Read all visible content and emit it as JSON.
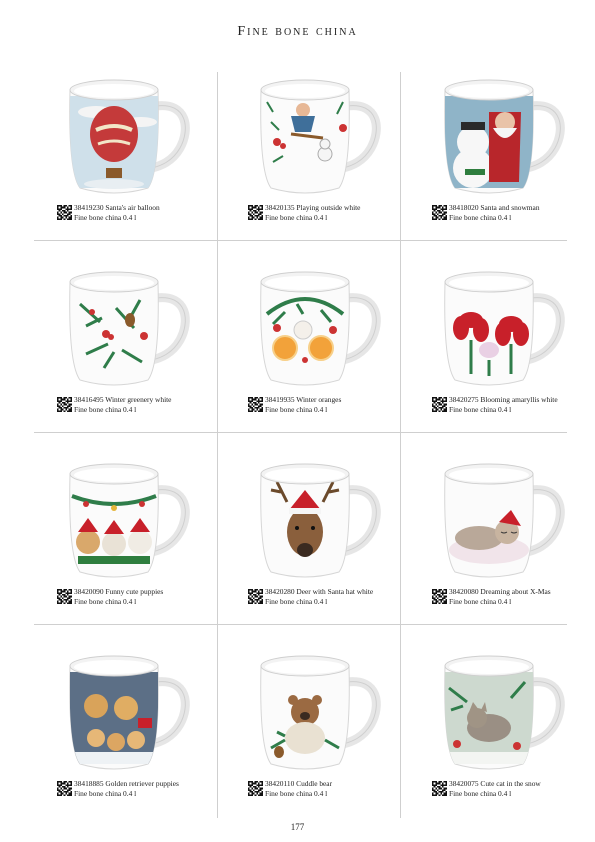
{
  "header": {
    "title": "Fine bone china"
  },
  "products": [
    {
      "code_name": "38419230 Santa's air balloon",
      "material": "Fine bone china 0.4 l",
      "art": "balloon"
    },
    {
      "code_name": "38420135 Playing outside white",
      "material": "Fine bone china 0.4 l",
      "art": "playing"
    },
    {
      "code_name": "38418020 Santa and snowman",
      "material": "Fine bone china 0.4 l",
      "art": "santa"
    },
    {
      "code_name": "38416495 Winter greenery white",
      "material": "Fine bone china 0.4 l",
      "art": "greenery"
    },
    {
      "code_name": "38419935 Winter oranges",
      "material": "Fine bone china 0.4 l",
      "art": "oranges"
    },
    {
      "code_name": "38420275 Blooming amaryllis white",
      "material": "Fine bone china 0.4 l",
      "art": "amaryllis"
    },
    {
      "code_name": "38420090 Funny cute puppies",
      "material": "Fine bone china 0.4 l",
      "art": "puppies"
    },
    {
      "code_name": "38420280 Deer with Santa hat white",
      "material": "Fine bone china 0.4 l",
      "art": "deer"
    },
    {
      "code_name": "38420080 Dreaming about X-Mas",
      "material": "Fine bone china 0.4 l",
      "art": "cat"
    },
    {
      "code_name": "38418885 Golden retriever puppies",
      "material": "Fine bone china 0.4 l",
      "art": "retrievers"
    },
    {
      "code_name": "38420110 Cuddle bear",
      "material": "Fine bone china 0.4 l",
      "art": "bear"
    },
    {
      "code_name": "38420075 Cute cat in the snow",
      "material": "Fine bone china 0.4 l",
      "art": "snowcat"
    }
  ],
  "footer": {
    "page_number": "177"
  }
}
